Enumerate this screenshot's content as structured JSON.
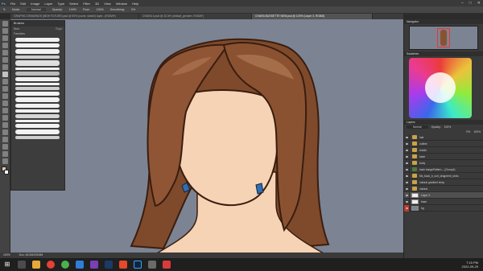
{
  "app": {
    "menu": [
      "File",
      "Edit",
      "Image",
      "Layer",
      "Type",
      "Select",
      "Filter",
      "3D",
      "View",
      "Window",
      "Help"
    ],
    "window_controls": [
      "–",
      "□",
      "✕"
    ]
  },
  "options_bar": {
    "items": [
      "Mode:",
      "Normal",
      "Opacity:",
      "100%",
      "Flow:",
      "100%",
      "Smoothing:",
      "0%"
    ]
  },
  "tabs": [
    {
      "label": "GRAPHIC DRAWINGS (NEW FUTURE).psd @ 50% (cover, skatch) layer...(RGB/8*)",
      "active": false
    },
    {
      "label": "CHARA 4.psd @ 33.3% (default_genderr..RGB/8*)",
      "active": false
    },
    {
      "label": "CHARA BUSSETTE NEW.psd @ 100% (Layer 3, RGB/8)",
      "active": true
    }
  ],
  "brush_panel": {
    "title": "Brushes",
    "size_label": "Size:",
    "size_value": "70 px",
    "group": "Favorites"
  },
  "right_panel": {
    "navigator_title": "Navigator",
    "swatches_title": "Swatches",
    "layers_title": "Layers",
    "blend_mode": "Normal",
    "opacity_label": "Opacity:",
    "opacity_value": "100%",
    "fill_label": "Fill:",
    "fill_value": "100%",
    "layers": [
      {
        "name": "hair",
        "type": "folder"
      },
      {
        "name": "outline",
        "type": "folder"
      },
      {
        "name": "shade",
        "type": "folder"
      },
      {
        "name": "base",
        "type": "folder"
      },
      {
        "name": "body",
        "type": "folder"
      },
      {
        "name": "back bangsPattern-...(Group4)",
        "type": "folder"
      },
      {
        "name": "bls_back_b_curl_dragment_shds",
        "type": "folder"
      },
      {
        "name": "natural gradient temp",
        "type": "folder"
      },
      {
        "name": "natural",
        "type": "folder"
      },
      {
        "name": "Layer 3",
        "type": "layer"
      },
      {
        "name": "base",
        "type": "layer"
      },
      {
        "name": "bg",
        "type": "layer"
      }
    ]
  },
  "status": {
    "zoom": "100%",
    "doc": "Doc: 48.2M/235.8M"
  },
  "taskbar": {
    "time": "7:15 PM",
    "date": "2022-09-29"
  },
  "colors": {
    "canvas_bg": "#7c8493",
    "hair": "#8b5231",
    "skin": "#f6d3b4",
    "earring": "#2f6fb3"
  }
}
